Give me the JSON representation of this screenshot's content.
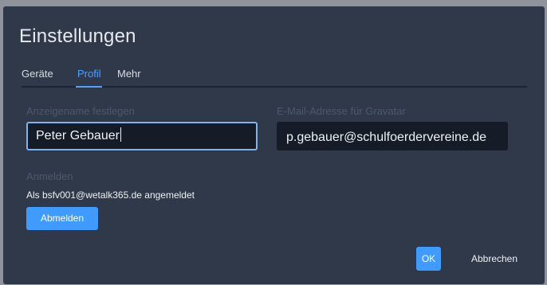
{
  "dialog": {
    "title": "Einstellungen"
  },
  "tabs": [
    {
      "label": "Geräte",
      "active": false
    },
    {
      "label": "Profil",
      "active": true
    },
    {
      "label": "Mehr",
      "active": false
    }
  ],
  "profile": {
    "display_name_label": "Anzeigename festlegen",
    "display_name_value": "Peter Gebauer",
    "email_label": "E-Mail-Adresse für Gravatar",
    "email_value": "p.gebauer@schulfoerdervereine.de"
  },
  "login": {
    "section_label": "Anmelden",
    "status_text": "Als bsfv001@wetalk365.de angemeldet",
    "logout_label": "Abmelden"
  },
  "footer": {
    "ok_label": "OK",
    "cancel_label": "Abbrechen"
  },
  "colors": {
    "dialog_bg": "#2f3949",
    "accent": "#3f9bff",
    "input_bg": "#151c27",
    "muted_label": "#4c596c"
  }
}
